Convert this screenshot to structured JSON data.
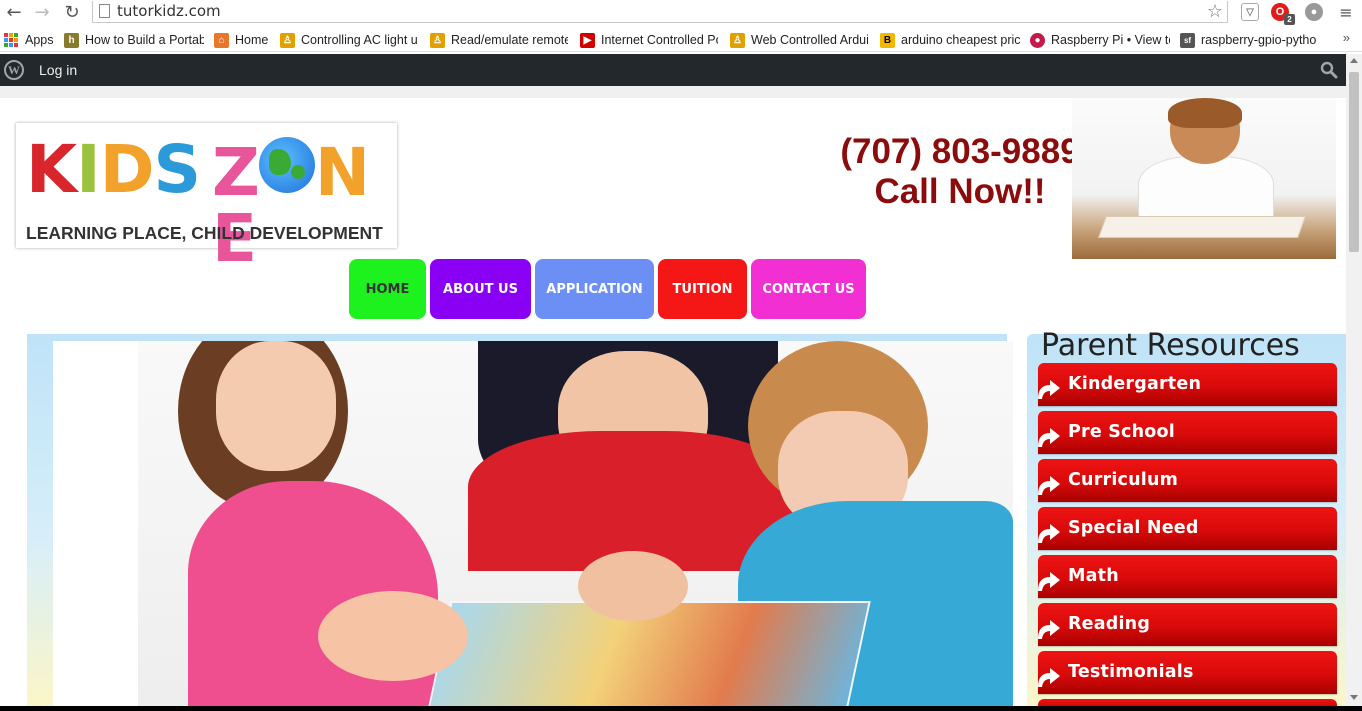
{
  "browser": {
    "url": "tutorkidz.com",
    "back_icon": "back-arrow-icon",
    "forward_icon": "forward-arrow-icon",
    "reload_icon": "reload-icon",
    "menu_icon": "hamburger-menu-icon",
    "opera_badge": "2"
  },
  "bookmarks": [
    {
      "label": "Apps",
      "icon": "apps-grid-icon"
    },
    {
      "label": "How to Build a Portab",
      "icon": "instructables-icon",
      "color": "#8a7a2e"
    },
    {
      "label": "Home",
      "icon": "xampp-icon",
      "color": "#e8762b"
    },
    {
      "label": "Controlling AC light u",
      "icon": "bookmark-person-icon",
      "color": "#e0a000"
    },
    {
      "label": "Read/emulate remote",
      "icon": "bookmark-person-icon",
      "color": "#e0a000"
    },
    {
      "label": "Internet Controlled Po",
      "icon": "youtube-icon",
      "color": "#d30000"
    },
    {
      "label": "Web Controlled Ardui",
      "icon": "bookmark-person-icon",
      "color": "#e0a000"
    },
    {
      "label": "arduino cheapest pric",
      "icon": "b-icon",
      "color": "#f2b800"
    },
    {
      "label": "Raspberry Pi • View to",
      "icon": "raspberry-icon",
      "color": "#c51a4a"
    },
    {
      "label": "raspberry-gpio-pytho",
      "icon": "sourceforge-icon",
      "color": "#555555"
    }
  ],
  "wpbar": {
    "login": "Log in"
  },
  "header": {
    "logo_tagline": "LEARNING PLACE, CHILD DEVELOPMENT",
    "phone": "(707) 803-9889",
    "cta": "Call Now!!"
  },
  "menu": [
    {
      "label": "HOME",
      "color": "#1ef21e",
      "text_color": "#333333",
      "width": 77
    },
    {
      "label": "ABOUT US",
      "color": "#8a00f5",
      "text_color": "#ffffff",
      "width": 101
    },
    {
      "label": "APPLICATION",
      "color": "#6b8ff5",
      "text_color": "#ffffff",
      "width": 119
    },
    {
      "label": "TUITION",
      "color": "#f51616",
      "text_color": "#ffffff",
      "width": 89
    },
    {
      "label": "CONTACT US",
      "color": "#f22fd2",
      "text_color": "#ffffff",
      "width": 115
    }
  ],
  "sidebar": {
    "title": "Parent Resources",
    "items": [
      "Kindergarten",
      "Pre School",
      "Curriculum",
      "Special Need",
      "Math",
      "Reading",
      "Testimonials"
    ]
  }
}
